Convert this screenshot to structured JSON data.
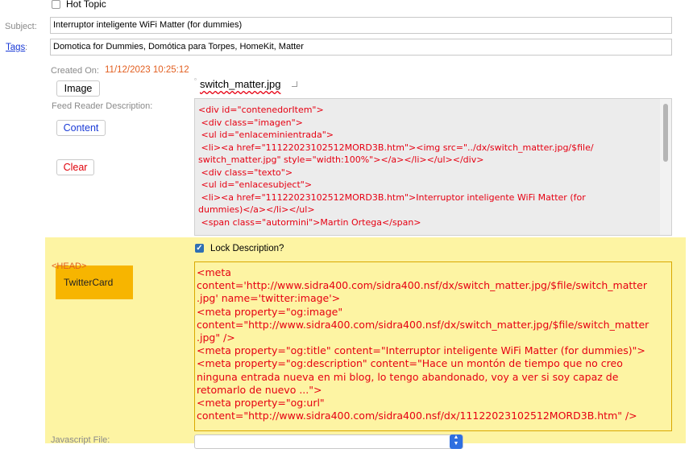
{
  "hot_topic": {
    "label": "Hot Topic",
    "checked": false
  },
  "subject": {
    "label": "Subject:",
    "value": "Interruptor inteligente WiFi Matter (for dummies)"
  },
  "tags": {
    "label": "Tags",
    "colon": ":",
    "value": "Domotica for Dummies, Domótica para Torpes, HomeKit, Matter"
  },
  "created": {
    "label": "Created On:",
    "value": "11/12/2023 10:25:12"
  },
  "image": {
    "button_label": "Image",
    "filename": "switch_matter.jpg"
  },
  "feed": {
    "label": "Feed Reader Description:",
    "content_button": "Content",
    "clear_button": "Clear",
    "lines": [
      "<div id=\"contenedorItem\">",
      " <div class=\"imagen\">",
      " <ul id=\"enlaceminientrada\">",
      " <li><a href=\"11122023102512MORD3B.htm\"><img src=\"../dx/switch_matter.jpg/$file/",
      "switch_matter.jpg\" style=\"width:100%\"></a></li></ul></div>",
      " <div class=\"texto\">",
      " <ul id=\"enlacesubject\">",
      " <li><a href=\"11122023102512MORD3B.htm\">Interruptor inteligente WiFi Matter (for",
      "dummies)</a></li></ul>",
      " <span class=\"autormini\">Martin Ortega</span>"
    ]
  },
  "lock": {
    "label": "Lock Description?",
    "checked": true
  },
  "head": {
    "label": "<HEAD>",
    "twitter_card": "TwitterCard",
    "lines": [
      "<meta",
      "content='http://www.sidra400.com/sidra400.nsf/dx/switch_matter.jpg/$file/switch_matter",
      ".jpg' name='twitter:image'>",
      "<meta property=\"og:image\"",
      "content=\"http://www.sidra400.com/sidra400.nsf/dx/switch_matter.jpg/$file/switch_matter",
      ".jpg\" />",
      "<meta property=\"og:title\" content=\"Interruptor inteligente WiFi Matter (for dummies)\">",
      "<meta property=\"og:description\" content=\"Hace un montón de tiempo que no creo",
      "ninguna entrada nueva en mi blog, lo tengo abandonado, voy a ver si soy capaz de",
      "retomarlo de nuevo ...\">",
      "<meta property=\"og:url\"",
      "content=\"http://www.sidra400.com/sidra400.nsf/dx/11122023102512MORD3B.htm\" />"
    ]
  },
  "javascript_file": {
    "label": "Javascript File:",
    "value": ""
  },
  "colors": {
    "highlight_bg": "#fdf4a3",
    "twitter_card_bg": "#f7b500",
    "code_red": "#e60012",
    "link_blue": "#1a3ad6",
    "created_value": "#e25e1f"
  }
}
